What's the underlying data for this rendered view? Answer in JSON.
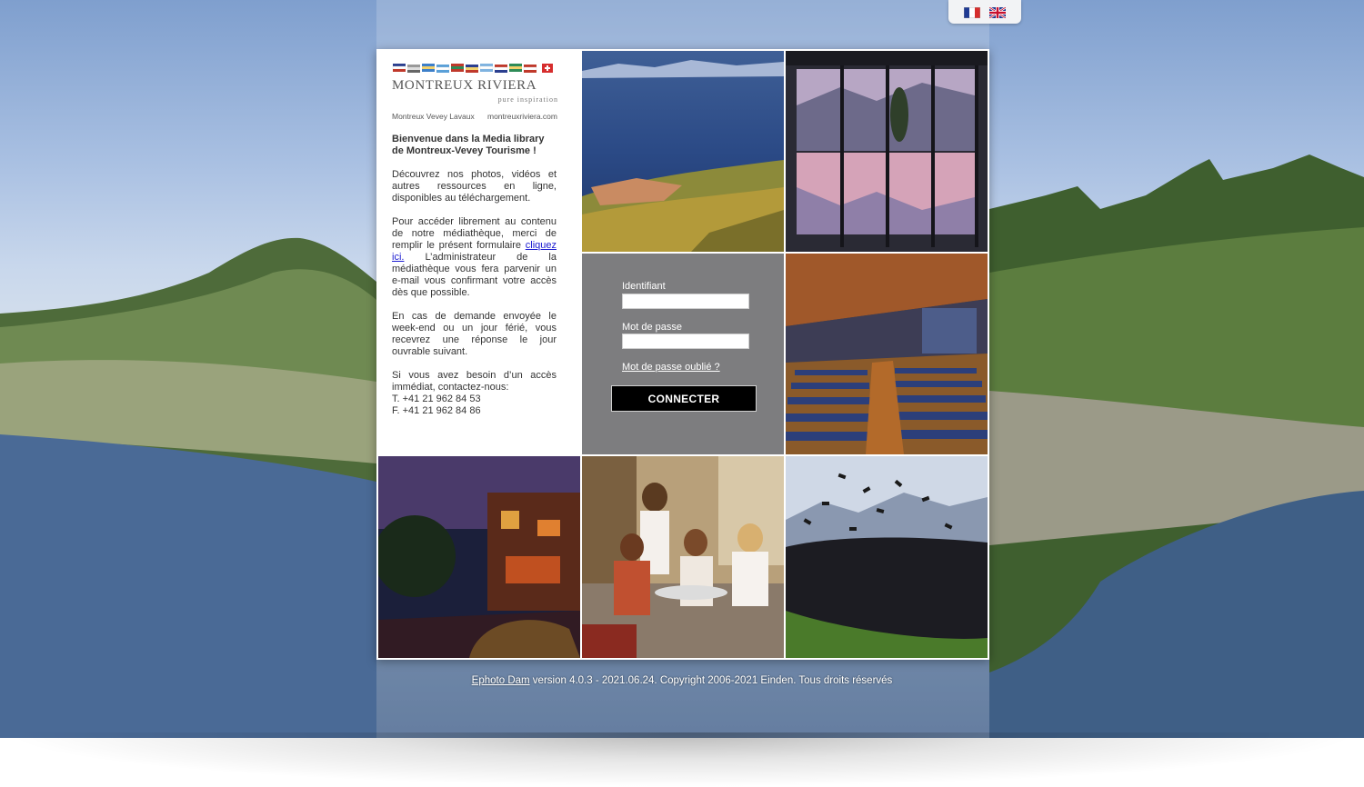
{
  "lang": {
    "fr_flag": "flag-fr",
    "en_flag": "flag-en"
  },
  "brand": {
    "name": "MONTREUX RIVIERA",
    "tagline": "pure inspiration",
    "region": "Montreux Vevey Lavaux",
    "website": "montreuxriviera.com"
  },
  "intro": {
    "welcome": "Bienvenue dans la Media library de Montreux-Vevey Tourisme !",
    "p1": "Découvrez nos photos, vidéos et autres ressources en ligne, disponibles au téléchargement.",
    "p2_before": "Pour accéder librement au contenu de notre médiathèque, merci de remplir le présent formulaire ",
    "p2_link": "cliquez ici.",
    "p2_after": " L’administrateur de la médiathèque vous fera parvenir un e-mail vous confirmant votre accès dès que possible.",
    "p3": "En cas de demande envoyée le week-end ou un jour férié, vous recevrez une réponse le jour ouvrable suivant.",
    "p4": "Si vous avez besoin d’un accès immédiat, contactez-nous:",
    "phone": "T. +41 21 962 84 53",
    "fax": "F. +41 21 962 84 86"
  },
  "login": {
    "username_label": "Identifiant",
    "username_value": "",
    "password_label": "Mot de passe",
    "password_value": "",
    "forgot": "Mot de passe oublié ?",
    "submit": "CONNECTER"
  },
  "footer": {
    "product_link": "Ephoto Dam",
    "text": " version 4.0.3 - 2021.06.24. Copyright 2006-2021 Einden. Tous droits réservés"
  },
  "colors": {
    "login_panel": "#7d7d7f",
    "link": "#1a1ad0",
    "button": "#000000"
  }
}
